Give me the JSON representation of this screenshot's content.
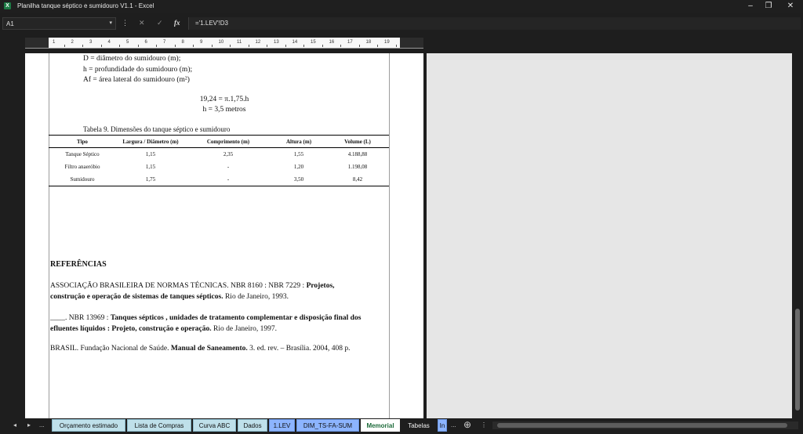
{
  "window": {
    "title": "Planilha tanque séptico e sumidouro V1.1 - Excel",
    "app_icon": "X",
    "minimize": "–",
    "restore": "❐",
    "close": "✕"
  },
  "formula_bar": {
    "name_box": "A1",
    "formula": "='1.LEV'!D3",
    "fx": "fx",
    "cancel": "✕",
    "enter": "✓",
    "more": "⋮"
  },
  "ruler": {
    "ticks": [
      "1",
      "2",
      "3",
      "4",
      "5",
      "6",
      "7",
      "8",
      "9",
      "10",
      "11",
      "12",
      "13",
      "14",
      "15",
      "16",
      "17",
      "18",
      "19"
    ]
  },
  "document": {
    "defs": [
      "D = diâmetro do sumidouro (m);",
      "h = profundidade do sumidouro (m);",
      "Af = área lateral do sumidouro (m²)"
    ],
    "equation_1": "19,24 = π.1,75.h",
    "equation_2": "h = 3,5 metros",
    "table_caption": "Tabela 9. Dimensões do tanque séptico e sumidouro",
    "table_headers": [
      "Tipo",
      "Largura / Diâmetro (m)",
      "Comprimento (m)",
      "Altura (m)",
      "Volume (L)"
    ],
    "table_rows": [
      [
        "Tanque Séptico",
        "1,15",
        "2,35",
        "1,55",
        "4.188,88"
      ],
      [
        "Filtro anaeróbio",
        "1,15",
        "-",
        "1,20",
        "1.198,08"
      ],
      [
        "Sumidouro",
        "1,75",
        "-",
        "3,50",
        "8,42"
      ]
    ],
    "refs_title": "REFERÊNCIAS",
    "ref1_line1_a": "ASSOCIAÇÃO BRASILEIRA DE NORMAS TÉCNICAS. NBR 8160 :  NBR 7229 : ",
    "ref1_line1_b": "Projetos,",
    "ref1_line2_a": "construção e operação de sistemas de tanques sépticos.",
    "ref1_line2_b": " Rio de Janeiro, 1993.",
    "ref2_line1_a": "____. NBR 13969 : ",
    "ref2_line1_b": "Tanques sépticos , unidades de tratamento complementar e disposição final dos",
    "ref2_line2_a": "efluentes líquidos : Projeto, construção e operação.",
    "ref2_line2_b": " Rio de Janeiro, 1997.",
    "ref3_a": "BRASIL. Fundação Nacional de Saúde. ",
    "ref3_b": "Manual de Saneamento.",
    "ref3_c": " 3. ed. rev. – Brasília. 2004, 408 p."
  },
  "sheet_tabs": {
    "nav_prev": "◂",
    "nav_next": "▸",
    "more_left": "...",
    "tabs": [
      "Orçamento estimado",
      "Lista de Compras",
      "Curva ABC",
      "Dados",
      "1.LEV",
      "DIM_TS-FA-SUM",
      "Memorial",
      "Tabelas",
      "In"
    ],
    "more_right": "...",
    "add": "⊕",
    "options": "⋮"
  }
}
